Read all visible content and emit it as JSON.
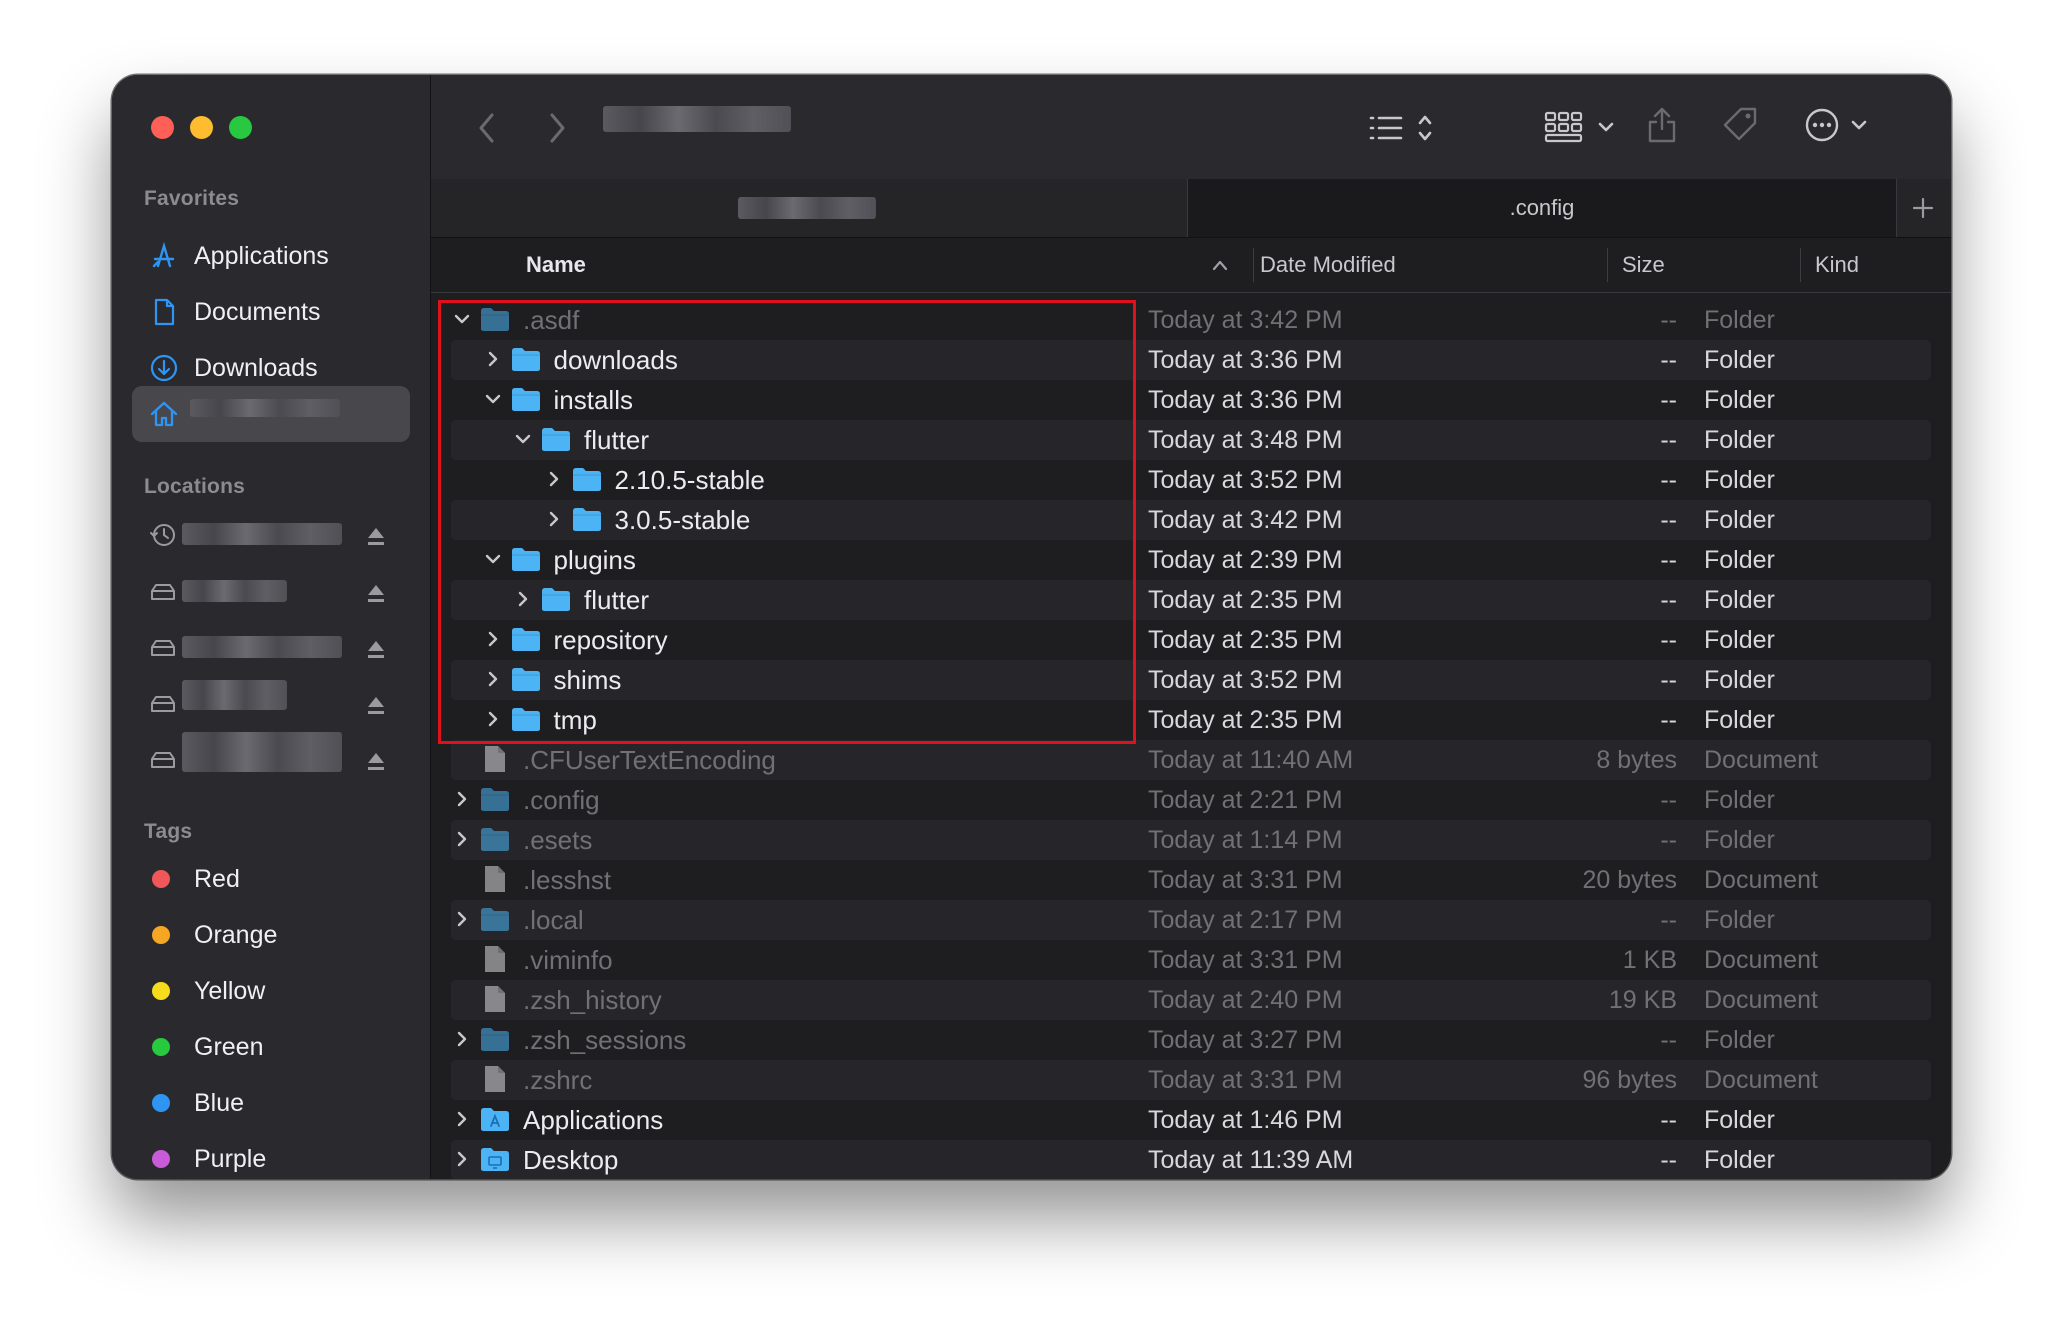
{
  "sidebar": {
    "favorites_heading": "Favorites",
    "favorites": [
      {
        "label": "Applications",
        "icon": "applications-icon"
      },
      {
        "label": "Documents",
        "icon": "documents-icon"
      },
      {
        "label": "Downloads",
        "icon": "downloads-icon"
      },
      {
        "label": "",
        "icon": "home-icon",
        "selected": true
      }
    ],
    "locations_heading": "Locations",
    "tags_heading": "Tags",
    "tags": [
      {
        "label": "Red",
        "color": "#f0575a"
      },
      {
        "label": "Orange",
        "color": "#f5a623"
      },
      {
        "label": "Yellow",
        "color": "#f7dc1e"
      },
      {
        "label": "Green",
        "color": "#27c93f"
      },
      {
        "label": "Blue",
        "color": "#2f95f5"
      },
      {
        "label": "Purple",
        "color": "#c85bd8"
      }
    ]
  },
  "tabs": {
    "right_tab_label": ".config",
    "add_tab_label": "+"
  },
  "columns": {
    "name": "Name",
    "date": "Date Modified",
    "size": "Size",
    "kind": "Kind"
  },
  "rows": [
    {
      "name": ".asdf",
      "level": 0,
      "chevron": "down",
      "icon": "folder",
      "hidden": true,
      "date": "Today at 3:42 PM",
      "size": "--",
      "kind": "Folder"
    },
    {
      "name": "downloads",
      "level": 1,
      "chevron": "right",
      "icon": "folder",
      "date": "Today at 3:36 PM",
      "size": "--",
      "kind": "Folder"
    },
    {
      "name": "installs",
      "level": 1,
      "chevron": "down",
      "icon": "folder",
      "date": "Today at 3:36 PM",
      "size": "--",
      "kind": "Folder"
    },
    {
      "name": "flutter",
      "level": 2,
      "chevron": "down",
      "icon": "folder",
      "date": "Today at 3:48 PM",
      "size": "--",
      "kind": "Folder"
    },
    {
      "name": "2.10.5-stable",
      "level": 3,
      "chevron": "right",
      "icon": "folder",
      "date": "Today at 3:52 PM",
      "size": "--",
      "kind": "Folder"
    },
    {
      "name": "3.0.5-stable",
      "level": 3,
      "chevron": "right",
      "icon": "folder",
      "date": "Today at 3:42 PM",
      "size": "--",
      "kind": "Folder"
    },
    {
      "name": "plugins",
      "level": 1,
      "chevron": "down",
      "icon": "folder",
      "date": "Today at 2:39 PM",
      "size": "--",
      "kind": "Folder"
    },
    {
      "name": "flutter",
      "level": 2,
      "chevron": "right",
      "icon": "folder",
      "date": "Today at 2:35 PM",
      "size": "--",
      "kind": "Folder"
    },
    {
      "name": "repository",
      "level": 1,
      "chevron": "right",
      "icon": "folder",
      "date": "Today at 2:35 PM",
      "size": "--",
      "kind": "Folder"
    },
    {
      "name": "shims",
      "level": 1,
      "chevron": "right",
      "icon": "folder",
      "date": "Today at 3:52 PM",
      "size": "--",
      "kind": "Folder"
    },
    {
      "name": "tmp",
      "level": 1,
      "chevron": "right",
      "icon": "folder",
      "date": "Today at 2:35 PM",
      "size": "--",
      "kind": "Folder"
    },
    {
      "name": ".CFUserTextEncoding",
      "level": 0,
      "chevron": "none",
      "icon": "document",
      "hidden": true,
      "date": "Today at 11:40 AM",
      "size": "8 bytes",
      "kind": "Document"
    },
    {
      "name": ".config",
      "level": 0,
      "chevron": "right",
      "icon": "folder",
      "hidden": true,
      "date": "Today at 2:21 PM",
      "size": "--",
      "kind": "Folder"
    },
    {
      "name": ".esets",
      "level": 0,
      "chevron": "right",
      "icon": "folder",
      "hidden": true,
      "date": "Today at 1:14 PM",
      "size": "--",
      "kind": "Folder"
    },
    {
      "name": ".lesshst",
      "level": 0,
      "chevron": "none",
      "icon": "document",
      "hidden": true,
      "date": "Today at 3:31 PM",
      "size": "20 bytes",
      "kind": "Document"
    },
    {
      "name": ".local",
      "level": 0,
      "chevron": "right",
      "icon": "folder",
      "hidden": true,
      "date": "Today at 2:17 PM",
      "size": "--",
      "kind": "Folder"
    },
    {
      "name": ".viminfo",
      "level": 0,
      "chevron": "none",
      "icon": "document",
      "hidden": true,
      "date": "Today at 3:31 PM",
      "size": "1 KB",
      "kind": "Document"
    },
    {
      "name": ".zsh_history",
      "level": 0,
      "chevron": "none",
      "icon": "document",
      "hidden": true,
      "date": "Today at 2:40 PM",
      "size": "19 KB",
      "kind": "Document"
    },
    {
      "name": ".zsh_sessions",
      "level": 0,
      "chevron": "right",
      "icon": "folder",
      "hidden": true,
      "date": "Today at 3:27 PM",
      "size": "--",
      "kind": "Folder"
    },
    {
      "name": ".zshrc",
      "level": 0,
      "chevron": "none",
      "icon": "document",
      "hidden": true,
      "date": "Today at 3:31 PM",
      "size": "96 bytes",
      "kind": "Document"
    },
    {
      "name": "Applications",
      "level": 0,
      "chevron": "right",
      "icon": "applications-folder",
      "date": "Today at 1:46 PM",
      "size": "--",
      "kind": "Folder"
    },
    {
      "name": "Desktop",
      "level": 0,
      "chevron": "right",
      "icon": "desktop-folder",
      "date": "Today at 11:39 AM",
      "size": "--",
      "kind": "Folder"
    }
  ],
  "colors": {
    "accent": "#2f95f5",
    "folder": "#4cb4f5",
    "highlight_box": "#e0101c"
  }
}
